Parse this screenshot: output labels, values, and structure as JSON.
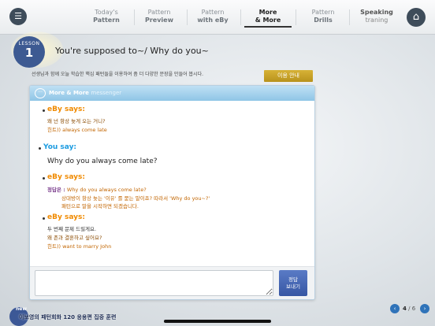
{
  "nav": {
    "tabs": [
      {
        "line1": "Today's",
        "line2": "Pattern"
      },
      {
        "line1": "Pattern",
        "line2": "Preview"
      },
      {
        "line1": "Pattern",
        "line2": "with eBy"
      },
      {
        "line1": "More",
        "line2": "& More"
      },
      {
        "line1": "Pattern",
        "line2": "Drills"
      },
      {
        "line1": "Speaking",
        "line2": "traning"
      }
    ],
    "menu_icon": "hamburger-list-icon",
    "home_icon": "home-icon",
    "menu_glyph": "☰",
    "home_glyph": "⌂"
  },
  "lesson": {
    "label": "LESSON",
    "number": "1",
    "title": "You're supposed to~/ Why do you~",
    "instruction": "선생님과 함께 오늘 학습한 핵심 패턴들을 이용하여 좀 더 다양한 문장을 만들어 봅시다.",
    "guide_button": "이용 안내"
  },
  "messenger": {
    "title": "More & More",
    "subtitle": "messenger",
    "icon_glyph": "···",
    "messages": [
      {
        "speaker": "eBy says:",
        "lines": [
          "왜 넌 항상 늦게 오는 거니?",
          "힌트)) always come late"
        ]
      },
      {
        "speaker": "You say:",
        "text": "Why do you always come late?"
      },
      {
        "speaker": "eBy says:",
        "answer_label": "정답은 :",
        "lines": [
          "Why do you always come late?",
          "상대방이 항상 늦는 '이유' 를 묻는 말이죠? 따라서 'Why do you~?'",
          "패턴으로 말을 시작하면 되겠습니다."
        ]
      },
      {
        "speaker": "eBy says:",
        "lines": [
          "두 번째 문제 드릴게요.",
          "왜 존과 결혼하고 싶어요?",
          "힌트)) want to marry John"
        ]
      }
    ],
    "input_value": "",
    "send_button": {
      "line1": "정답",
      "line2": "보내기"
    }
  },
  "footer": {
    "logo_new": "new",
    "logo_text": "이보영의 패턴회화 120 응용편 집중 훈련",
    "page_current": "4",
    "page_sep": " / ",
    "page_total": "6",
    "prev_glyph": "‹",
    "next_glyph": "›"
  },
  "colors": {
    "accent_blue": "#3d5a92",
    "eby_orange": "#f08a00",
    "you_blue": "#1b9be0",
    "guide_gold": "#c9a22a"
  }
}
